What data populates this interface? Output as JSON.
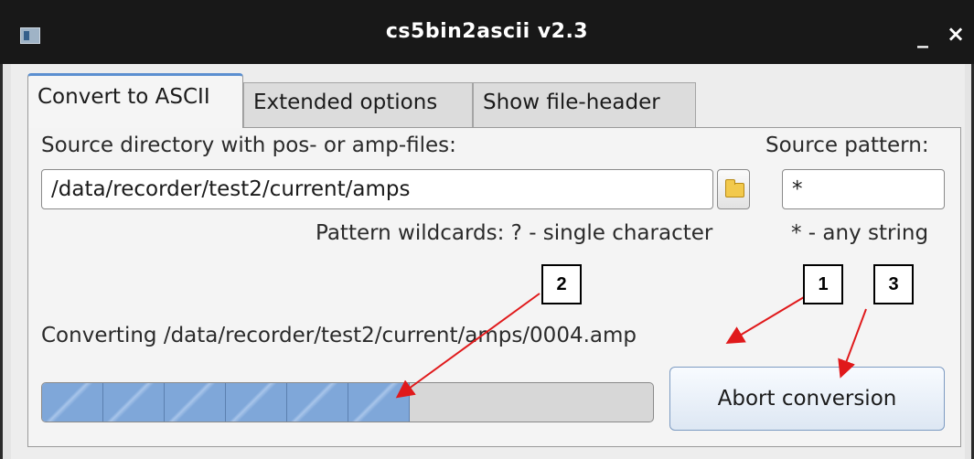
{
  "window": {
    "title": "cs5bin2ascii v2.3",
    "minimize": "_",
    "close": "×"
  },
  "tabs": [
    {
      "label": "Convert to ASCII",
      "active": true
    },
    {
      "label": "Extended options",
      "active": false
    },
    {
      "label": "Show file-header",
      "active": false
    }
  ],
  "source": {
    "dir_label": "Source directory with pos- or amp-files:",
    "dir_value": "/data/recorder/test2/current/amps",
    "pattern_label": "Source pattern:",
    "pattern_value": "*",
    "wildcards_hint": "Pattern wildcards: ? - single character",
    "wildcards_any": "* - any string"
  },
  "status": {
    "converting_text": "Converting /data/recorder/test2/current/amps/0004.amp"
  },
  "progress": {
    "filled_segments": 6,
    "fraction": 0.6,
    "color": "#7fa7d9"
  },
  "abort_button": {
    "label": "Abort conversion"
  },
  "callouts": [
    "1",
    "2",
    "3"
  ],
  "annotation_color": "#e0191b",
  "icons": {
    "folder": "folder-icon",
    "app": "app-icon"
  }
}
